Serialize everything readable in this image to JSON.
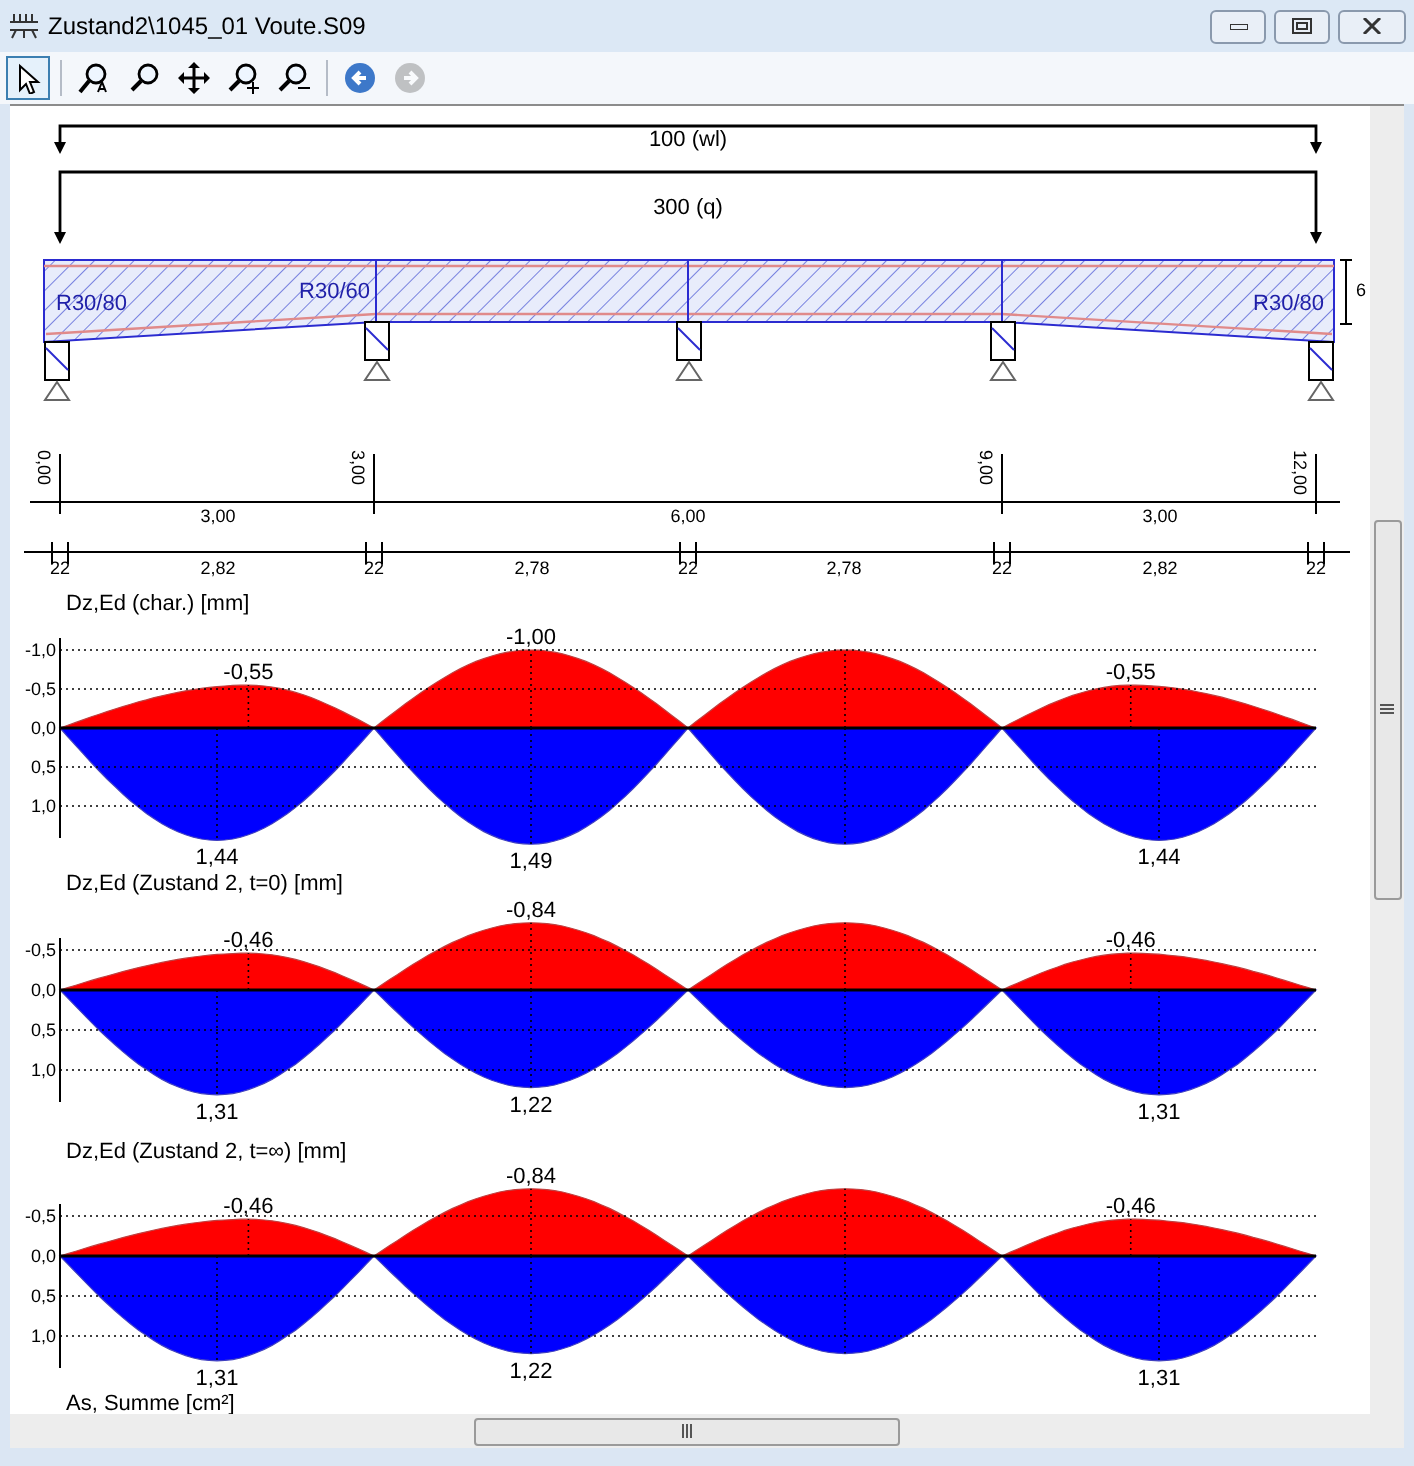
{
  "window": {
    "title": "Zustand2\\1045_01 Voute.S09"
  },
  "toolbar": [
    {
      "kind": "pointer",
      "selected": true
    },
    {
      "kind": "zoom-all",
      "selected": false
    },
    {
      "kind": "zoom",
      "selected": false
    },
    {
      "kind": "pan",
      "selected": false
    },
    {
      "kind": "zoom-in",
      "selected": false
    },
    {
      "kind": "zoom-out",
      "selected": false
    },
    {
      "kind": "back",
      "disabled": false
    },
    {
      "kind": "forward",
      "disabled": true
    }
  ],
  "loads": [
    "100 (wl)",
    "300 (q)"
  ],
  "beam": {
    "sections": [
      "R30/80",
      "R30/60",
      "R30/80"
    ],
    "height_dimension": "6"
  },
  "axis": {
    "stations": [
      "0,00",
      "3,00",
      "9,00",
      "12,00"
    ],
    "spans": [
      "3,00",
      "6,00",
      "3,00"
    ]
  },
  "segments": {
    "supports": [
      "22",
      "22",
      "22",
      "22",
      "22"
    ],
    "clear_spans": [
      "2,82",
      "2,78",
      "2,78",
      "2,82"
    ]
  },
  "diagrams": [
    {
      "title": "Dz,Ed (char.) [mm]",
      "ticks": [
        "-1,0",
        "-0,5",
        "0,0",
        "0,5",
        "1,0"
      ],
      "top_labels": [
        "-0,55",
        "-1,00",
        "-0,55"
      ],
      "bottom_labels": [
        "1,44",
        "1,49",
        "1,44"
      ]
    },
    {
      "title": "Dz,Ed (Zustand 2, t=0) [mm]",
      "ticks": [
        "-0,5",
        "0,0",
        "0,5",
        "1,0"
      ],
      "top_labels": [
        "-0,46",
        "-0,84",
        "-0,46"
      ],
      "bottom_labels": [
        "1,31",
        "1,22",
        "1,31"
      ]
    },
    {
      "title": "Dz,Ed (Zustand 2, t=∞) [mm]",
      "ticks": [
        "-0,5",
        "0,0",
        "0,5",
        "1,0"
      ],
      "top_labels": [
        "-0,46",
        "-0,84",
        "-0,46"
      ],
      "bottom_labels": [
        "1,31",
        "1,22",
        "1,31"
      ]
    }
  ],
  "next_heading": "As, Summe [cm²]"
}
